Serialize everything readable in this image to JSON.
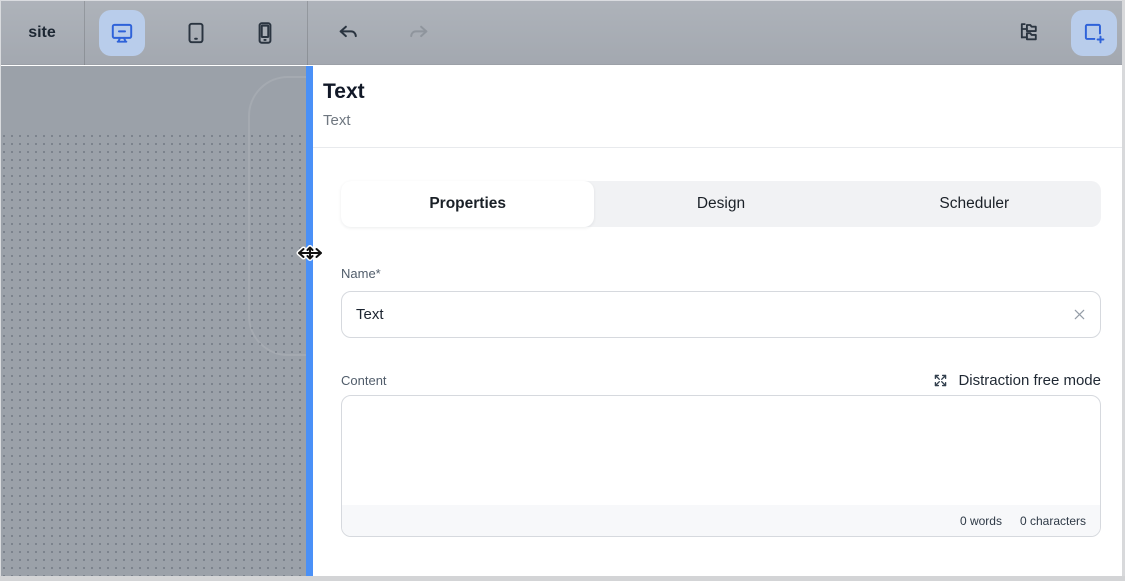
{
  "toolbar": {
    "site_label": "site",
    "device_buttons": [
      {
        "name": "desktop",
        "icon": "desktop-monitor-icon",
        "active": true
      },
      {
        "name": "tablet",
        "icon": "tablet-icon",
        "active": false
      },
      {
        "name": "phone",
        "icon": "phone-icon",
        "active": false
      }
    ],
    "undo_icon": "undo-arrow",
    "redo_icon": "redo-arrow",
    "tree_icon": "page-tree",
    "add_icon": "add-section-square-plus"
  },
  "panel": {
    "title": "Text",
    "subtitle": "Text",
    "tabs": [
      {
        "label": "Properties",
        "active": true
      },
      {
        "label": "Design",
        "active": false
      },
      {
        "label": "Scheduler",
        "active": false
      }
    ],
    "name_field": {
      "label": "Name*",
      "value": "Text",
      "clear_icon": "clear-x"
    },
    "content_field": {
      "label": "Content",
      "value": "",
      "distraction_free_label": "Distraction free mode",
      "expand_icon": "expand-arrows",
      "word_count": "0 words",
      "character_count": "0 characters"
    }
  },
  "colors": {
    "accent_blue": "#2e62d9",
    "active_button_bg": "#b9cdeb",
    "divider_blue": "#4a90f7",
    "toolbar_bg": "#a7acb4",
    "canvas_bg": "#9ba1a9"
  }
}
